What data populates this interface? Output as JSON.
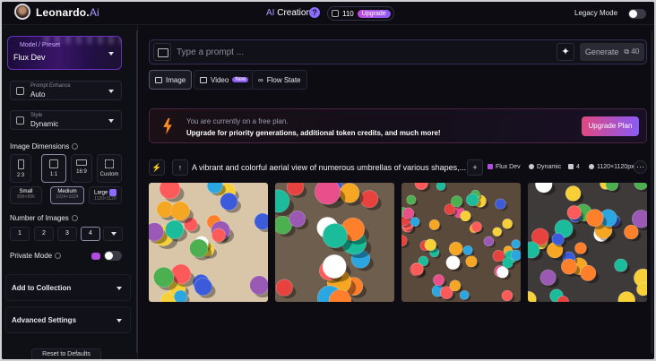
{
  "topbar": {
    "brand_name": "Leonardo.",
    "brand_suffix": "Ai",
    "mode_prefix": "AI",
    "mode_title": " Creation",
    "help_glyph": "?",
    "credits": "110",
    "upgrade": "Upgrade",
    "legacy_mode": "Legacy Mode"
  },
  "sidebar": {
    "model_label": "Model / Preset",
    "model_value": "Flux Dev",
    "prompt_enhance_label": "Prompt Enhance",
    "prompt_enhance_value": "Auto",
    "style_label": "Style",
    "style_value": "Dynamic",
    "image_dimensions": "Image Dimensions",
    "ratios": [
      "2:3",
      "1:1",
      "16:9",
      "Custom"
    ],
    "sizes": [
      {
        "label": "Small",
        "dims": "896×896"
      },
      {
        "label": "Medium",
        "dims": "1024×1024"
      },
      {
        "label": "Large",
        "dims": "1120×1120"
      }
    ],
    "number_of_images": "Number of Images",
    "numbers": [
      "1",
      "2",
      "3",
      "4"
    ],
    "private_mode": "Private Mode",
    "add_to_collection": "Add to Collection",
    "advanced_settings": "Advanced Settings",
    "reset": "Reset to Defaults"
  },
  "main": {
    "prompt_placeholder": "Type a prompt ...",
    "generate": "Generate",
    "generate_cost": "40",
    "tabs": [
      {
        "label": "Image"
      },
      {
        "label": "Video",
        "badge": "New"
      },
      {
        "label": "Flow State"
      }
    ],
    "banner_line1": "You are currently on a free plan.",
    "banner_line2": "Upgrade for priority generations, additional token credits, and much more!",
    "upgrade_plan": "Upgrade Plan",
    "generation_prompt": "A vibrant and colorful aerial view of numerous umbrellas of various shapes,...",
    "meta_model": "Flux Dev",
    "meta_style": "Dynamic",
    "meta_count": "4",
    "meta_size": "1120×1120px",
    "more_glyph": "···"
  },
  "colors": {
    "background": "#0c0c12",
    "accent_purple": "#8c5cf5",
    "upgrade_pink": "#e0487f",
    "bolt_orange": "#ff8a1d"
  }
}
